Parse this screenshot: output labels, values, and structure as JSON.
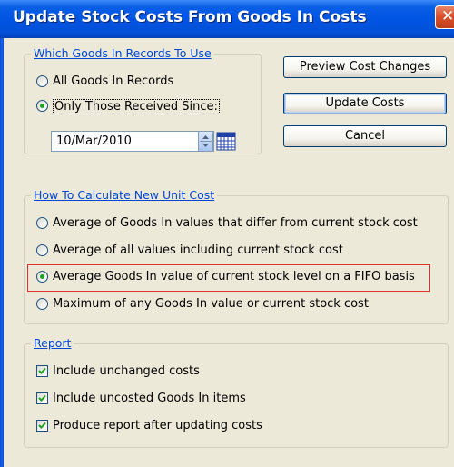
{
  "window": {
    "title": "Update Stock Costs From Goods In Costs",
    "close_glyph": "✕"
  },
  "records_group": {
    "legend": "Which Goods In Records To Use",
    "options": [
      {
        "label": "All Goods In Records",
        "selected": false
      },
      {
        "label": "Only Those Received Since:",
        "selected": true
      }
    ],
    "date_value": "10/Mar/2010"
  },
  "buttons": {
    "preview": "Preview Cost Changes",
    "update": "Update Costs",
    "cancel": "Cancel"
  },
  "calc_group": {
    "legend": "How To Calculate New Unit Cost",
    "options": [
      {
        "label": "Average of Goods In values that differ from current stock cost",
        "selected": false
      },
      {
        "label": "Average of all values including current stock cost",
        "selected": false
      },
      {
        "label": "Average Goods In value of current stock level on a FIFO basis",
        "selected": true
      },
      {
        "label": "Maximum of any Goods In value or current stock cost",
        "selected": false
      }
    ]
  },
  "report_group": {
    "legend": "Report",
    "options": [
      {
        "label": "Include unchanged costs",
        "checked": true
      },
      {
        "label": "Include uncosted Goods In items",
        "checked": true
      },
      {
        "label": "Produce report after updating costs",
        "checked": true
      }
    ]
  },
  "colors": {
    "title_bar": "#0054e3",
    "highlight": "#e53030",
    "radio_dot": "#21a121",
    "check_mark": "#21a121"
  },
  "icons": {
    "close": "close-icon",
    "spin": "spinner-icon",
    "calendar": "calendar-icon"
  }
}
